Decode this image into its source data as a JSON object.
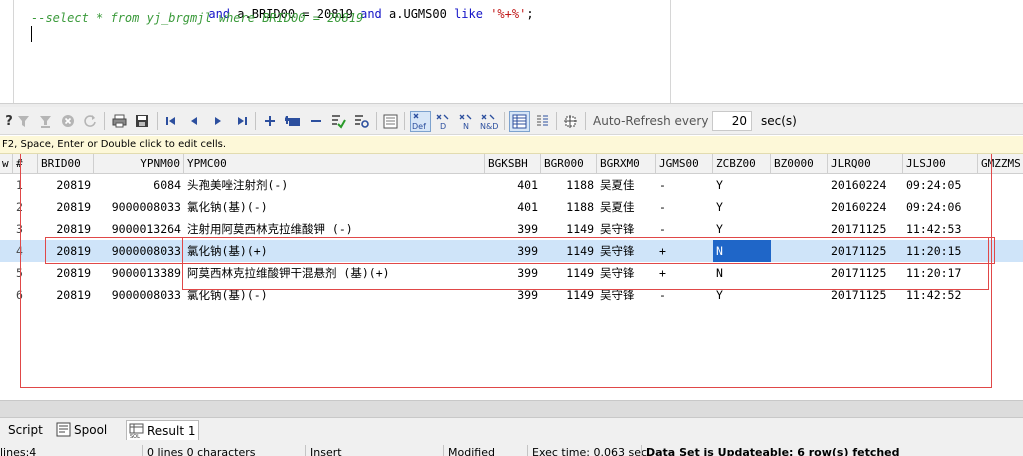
{
  "editor": {
    "line1": [
      "and",
      "a.BRID00 = 20819",
      "and",
      "a.UGMS00",
      "like",
      "'%+%'"
    ],
    "line2": "--select * from yj_brgmjl where BRID00 = 20819"
  },
  "toolbar": {
    "icons": [
      "help",
      "filter",
      "filter-clear",
      "cancel",
      "refresh",
      "print",
      "save",
      "first",
      "previous",
      "next",
      "last",
      "insert",
      "duplicate",
      "delete",
      "post",
      "refresh-record",
      "single-record",
      "default",
      "d",
      "n",
      "n-and-d",
      "grid-view",
      "form-view",
      "expand"
    ],
    "auto_refresh_label": "Auto-Refresh every",
    "auto_refresh_value": "20",
    "auto_refresh_unit": "sec(s)"
  },
  "hint": "F2, Space, Enter or Double click to edit cells.",
  "grid": {
    "columns": [
      "w",
      "#",
      "BRID00",
      "YPNM00",
      "YPMC00",
      "BGKSBH",
      "BGR000",
      "BGRXM0",
      "JGMS00",
      "ZCBZ00",
      "BZ0000",
      "JLRQ00",
      "JLSJ00",
      "GMZZMS"
    ],
    "rows": [
      {
        "n": "1",
        "brid": "20819",
        "ypnm": "6084",
        "ypmc": "头孢美唑注射剂(-)",
        "bgksbh": "401",
        "bgr": "1188",
        "bgrxm": "吴夏佳",
        "jgms": "-",
        "zcbz": "Y",
        "bz": "",
        "jlrq": "20160224",
        "jlsj": "09:24:05"
      },
      {
        "n": "2",
        "brid": "20819",
        "ypnm": "9000008033",
        "ypmc": "氯化钠(基)(-)",
        "bgksbh": "401",
        "bgr": "1188",
        "bgrxm": "吴夏佳",
        "jgms": "-",
        "zcbz": "Y",
        "bz": "",
        "jlrq": "20160224",
        "jlsj": "09:24:06"
      },
      {
        "n": "3",
        "brid": "20819",
        "ypnm": "9000013264",
        "ypmc": "注射用阿莫西林克拉维酸钾 (-)",
        "bgksbh": "399",
        "bgr": "1149",
        "bgrxm": "吴守锋",
        "jgms": "-",
        "zcbz": "Y",
        "bz": "",
        "jlrq": "20171125",
        "jlsj": "11:42:53"
      },
      {
        "n": "4",
        "brid": "20819",
        "ypnm": "9000008033",
        "ypmc": "氯化钠(基)(+)",
        "bgksbh": "399",
        "bgr": "1149",
        "bgrxm": "吴守锋",
        "jgms": "+",
        "zcbz": "N",
        "bz": "",
        "jlrq": "20171125",
        "jlsj": "11:20:15"
      },
      {
        "n": "5",
        "brid": "20819",
        "ypnm": "9000013389",
        "ypmc": "阿莫西林克拉维酸钾干混悬剂 (基)(+)",
        "bgksbh": "399",
        "bgr": "1149",
        "bgrxm": "吴守锋",
        "jgms": "+",
        "zcbz": "N",
        "bz": "",
        "jlrq": "20171125",
        "jlsj": "11:20:17"
      },
      {
        "n": "6",
        "brid": "20819",
        "ypnm": "9000008033",
        "ypmc": "氯化钠(基)(-)",
        "bgksbh": "399",
        "bgr": "1149",
        "bgrxm": "吴守锋",
        "jgms": "-",
        "zcbz": "Y",
        "bz": "",
        "jlrq": "20171125",
        "jlsj": "11:42:52"
      }
    ]
  },
  "tabs": [
    {
      "label": "Script"
    },
    {
      "label": "Spool"
    },
    {
      "label": "Result 1"
    }
  ],
  "status": {
    "lines": "lines:4",
    "chars": "0 lines 0 characters",
    "mode": "Insert",
    "modified": "Modified",
    "exec": "Exec time: 0.063 sec",
    "result": "Data Set is Updateable: 6 row(s) fetched"
  }
}
